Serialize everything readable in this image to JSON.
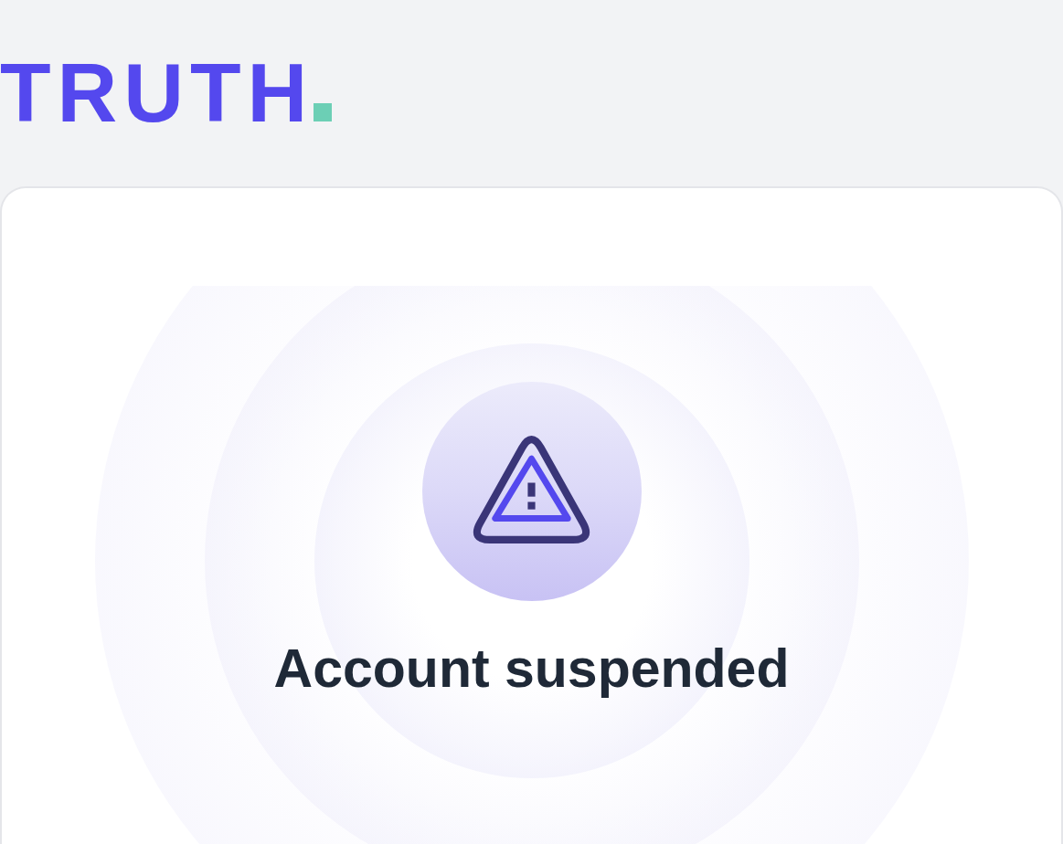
{
  "logo": {
    "text": "TRUTH"
  },
  "card": {
    "title": "Account suspended"
  }
}
